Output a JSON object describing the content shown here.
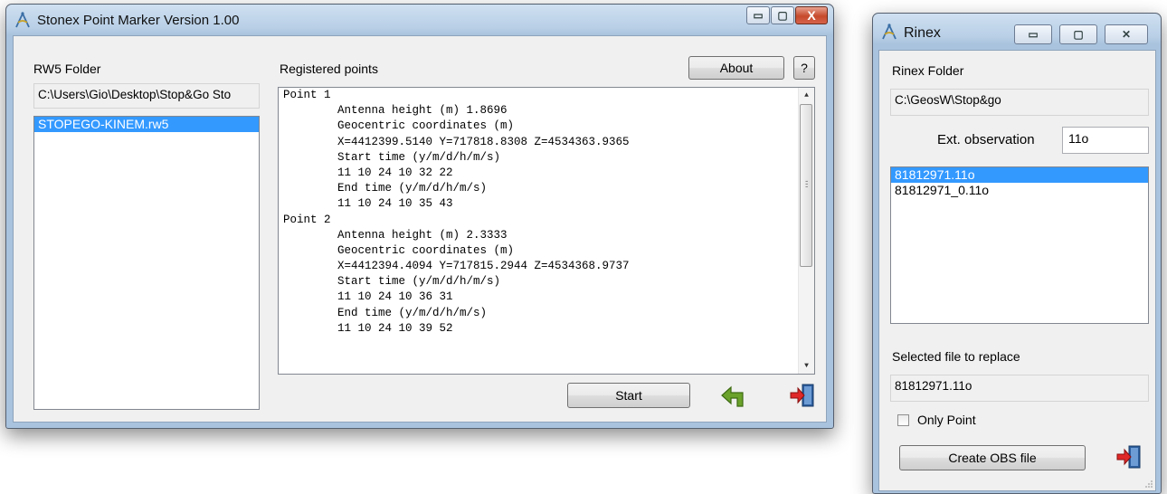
{
  "main_window": {
    "title": "Stonex Point Marker Version 1.00",
    "controls": {
      "minimize": "▭",
      "maximize": "▢",
      "close": "X"
    },
    "rw5_folder_label": "RW5 Folder",
    "rw5_folder_path": "C:\\Users\\Gio\\Desktop\\Stop&Go Sto",
    "rw5_files": [
      {
        "name": "STOPEGO-KINEM.rw5",
        "selected": true
      }
    ],
    "registered_label": "Registered points",
    "about_label": "About",
    "help_label": "?",
    "start_label": "Start",
    "registered_lines": [
      "Point 1",
      "        Antenna height (m) 1.8696",
      "        Geocentric coordinates (m)",
      "        X=4412399.5140 Y=717818.8308 Z=4534363.9365",
      "        Start time (y/m/d/h/m/s)",
      "        11 10 24 10 32 22",
      "        End time (y/m/d/h/m/s)",
      "        11 10 24 10 35 43",
      "Point 2",
      "        Antenna height (m) 2.3333",
      "        Geocentric coordinates (m)",
      "        X=4412394.4094 Y=717815.2944 Z=4534368.9737",
      "        Start time (y/m/d/h/m/s)",
      "        11 10 24 10 36 31",
      "        End time (y/m/d/h/m/s)",
      "        11 10 24 10 39 52"
    ],
    "icons": {
      "back": "back-arrow-icon",
      "exit": "exit-door-icon"
    }
  },
  "rinex_window": {
    "title": "Rinex",
    "controls": {
      "minimize": "▭",
      "maximize": "▢",
      "close": "✕"
    },
    "folder_label": "Rinex Folder",
    "folder_path": "C:\\GeosW\\Stop&go",
    "ext_label": "Ext. observation",
    "ext_value": "11o",
    "files": [
      {
        "name": "81812971.11o",
        "selected": true
      },
      {
        "name": "81812971_0.11o",
        "selected": false
      }
    ],
    "selected_label": "Selected file to replace",
    "selected_file": "81812971.11o",
    "only_point_label": "Only Point",
    "only_point_checked": false,
    "create_label": "Create OBS file"
  },
  "colors": {
    "selection": "#3399ff",
    "titlebar": "#b8cfe6",
    "arrow_green": "#5a8f1e",
    "exit_red": "#d62020"
  }
}
